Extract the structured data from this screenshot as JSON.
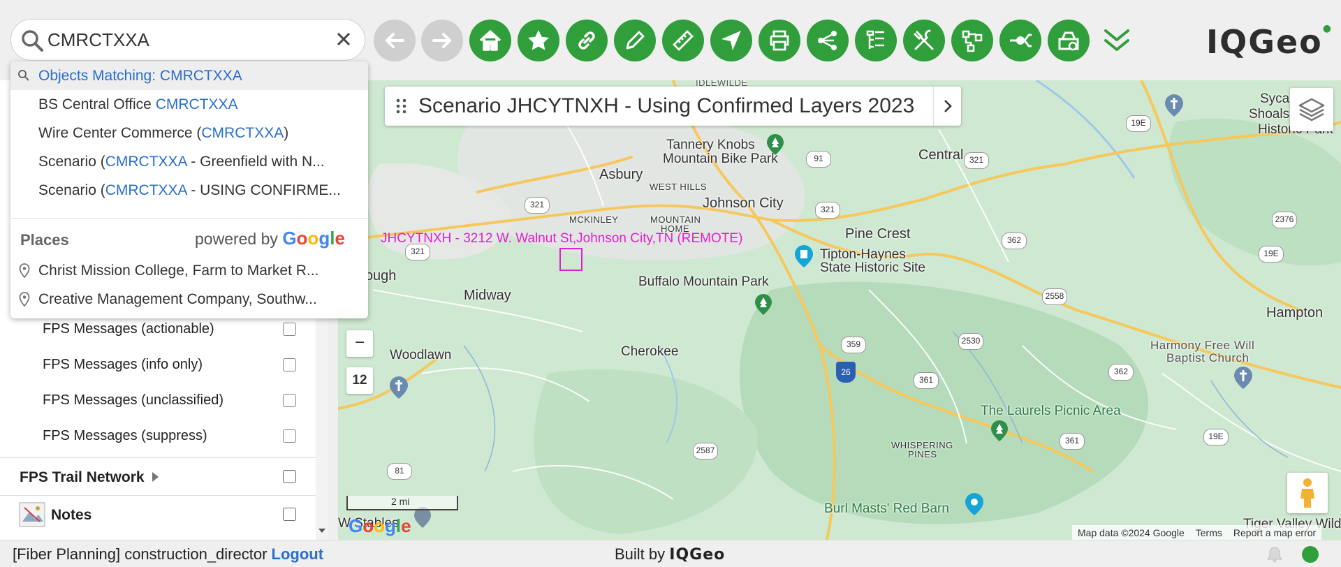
{
  "search": {
    "value": "CMRCTXXA",
    "placeholder": ""
  },
  "toolbar": {
    "buttons": [
      {
        "name": "back-button",
        "icon": "arrow-left-icon",
        "enabled": false
      },
      {
        "name": "forward-button",
        "icon": "arrow-right-icon",
        "enabled": false
      },
      {
        "name": "home-button",
        "icon": "home-icon",
        "enabled": true
      },
      {
        "name": "bookmarks-button",
        "icon": "star-icon",
        "enabled": true
      },
      {
        "name": "link-button",
        "icon": "link-icon",
        "enabled": true
      },
      {
        "name": "edit-button",
        "icon": "pencil-icon",
        "enabled": true
      },
      {
        "name": "measure-button",
        "icon": "ruler-icon",
        "enabled": true
      },
      {
        "name": "navigate-button",
        "icon": "navigation-arrow-icon",
        "enabled": true
      },
      {
        "name": "print-button",
        "icon": "printer-icon",
        "enabled": true
      },
      {
        "name": "share-button",
        "icon": "share-icon",
        "enabled": true
      },
      {
        "name": "tree-button",
        "icon": "tree-list-icon",
        "enabled": true
      },
      {
        "name": "tools-button",
        "icon": "tools-icon",
        "enabled": true
      },
      {
        "name": "network-trace-button",
        "icon": "network-icon",
        "enabled": true
      },
      {
        "name": "connect-button",
        "icon": "plug-icon",
        "enabled": true
      },
      {
        "name": "design-button",
        "icon": "design-icon",
        "enabled": true
      }
    ],
    "accent_color": "#2f9e3b",
    "disabled_color": "#cfcfcf"
  },
  "logo": {
    "text": "IQGeo"
  },
  "dropdown": {
    "items": [
      {
        "prefix": "Objects Matching: ",
        "match": "CMRCTXXA",
        "suffix": ""
      },
      {
        "prefix": "BS Central Office ",
        "match": "CMRCTXXA",
        "suffix": ""
      },
      {
        "prefix": "Wire Center Commerce (",
        "match": "CMRCTXXA",
        "suffix": ")"
      },
      {
        "prefix": "Scenario (",
        "match": "CMRCTXXA",
        "suffix": " - Greenfield with N..."
      },
      {
        "prefix": "Scenario (",
        "match": "CMRCTXXA",
        "suffix": " - USING CONFIRME..."
      }
    ],
    "places_header": "Places",
    "powered_by": "powered by",
    "google": "Google",
    "places": [
      {
        "label": "Christ Mission College, Farm to Market R..."
      },
      {
        "label": "Creative Management Company, Southw..."
      }
    ]
  },
  "layers": {
    "items": [
      {
        "label": "FPS Messages (actionable)",
        "checked": false
      },
      {
        "label": "FPS Messages (info only)",
        "checked": false
      },
      {
        "label": "FPS Messages (unclassified)",
        "checked": false
      },
      {
        "label": "FPS Messages (suppress)",
        "checked": false
      }
    ],
    "groups": [
      {
        "label": "FPS Trail Network",
        "checked": false
      },
      {
        "label": "Notes",
        "checked": false
      }
    ]
  },
  "map": {
    "scenario_title": "Scenario JHCYTNXH - Using Confirmed Layers 2023",
    "feature_label": "JHCYTNXH - 3212 W. Walnut St,Johnson City,TN (REMOTE)",
    "zoom_out": "−",
    "zoom_level": "12",
    "scale": "2 mi",
    "attribution": [
      "Map data ©2024 Google",
      "Terms",
      "Report a map error"
    ],
    "labels": [
      "IDLEWILDE",
      "Sycamore",
      "Shoals State",
      "Historic Park",
      "Tannery Knobs",
      "Mountain Bike Park",
      "Asbury",
      "WEST HILLS",
      "Johnson City",
      "Central",
      "MCKINLEY",
      "MOUNTAIN",
      "HOME",
      "Pine Crest",
      "Tipton-Haynes",
      "State Historic Site",
      "sborough",
      "Midway",
      "Buffalo Mountain Park",
      "Hampton",
      "Woodlawn",
      "Cherokee",
      "Harmony Free Will",
      "Baptist Church",
      "The Laurels Picnic Area",
      "WHISPERING",
      "PINES",
      "Burl Masts' Red Barn",
      "Tiger Valley Wilderness",
      "W Stables"
    ],
    "shields": [
      "91",
      "321",
      "321",
      "321",
      "321",
      "19E",
      "2376",
      "19E",
      "362",
      "2558",
      "359",
      "2530",
      "362",
      "361",
      "361",
      "19E",
      "2587",
      "81"
    ],
    "interstate": "26"
  },
  "status": {
    "user_text": "[Fiber Planning] construction_director",
    "logout": "Logout",
    "built_by": "Built by",
    "built_by_logo": "IQGeo",
    "status_color": "#2f9e3b"
  }
}
